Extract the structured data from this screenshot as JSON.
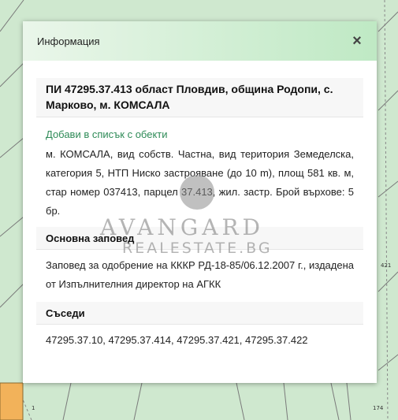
{
  "map": {
    "labels": [
      "421",
      "174",
      "1"
    ]
  },
  "dialog": {
    "title": "Информация",
    "close_symbol": "×",
    "parcel_heading": "ПИ 47295.37.413 област Пловдив, община Родопи, с. Марково, м. КОМСАЛА",
    "add_link": "Добави в списък с обекти",
    "description": "м. КОМСАЛА, вид собств. Частна, вид територия Земеделска, категория 5, НТП Ниско застрояване (до 10 m), площ 581 кв. м, стар номер 037413, парцел 37.413, жил. застр. Брой върхове: 5 бр.",
    "order_heading": "Основна заповед",
    "order_text": "Заповед за одобрение на КККР РД-18-85/06.12.2007 г., издадена от Изпълнителния директор на АГКК",
    "neighbors_heading": "Съседи",
    "neighbors_text": "47295.37.10, 47295.37.414, 47295.37.421, 47295.37.422"
  },
  "watermark": {
    "brand": "AVANGARD",
    "sub": "REALESTATE.BG"
  },
  "colors": {
    "map_green": "#cfe8cf",
    "parcel_orange": "#f2b25a",
    "link_green": "#2e8b57",
    "header_gradient_end": "#bfe9c4"
  }
}
